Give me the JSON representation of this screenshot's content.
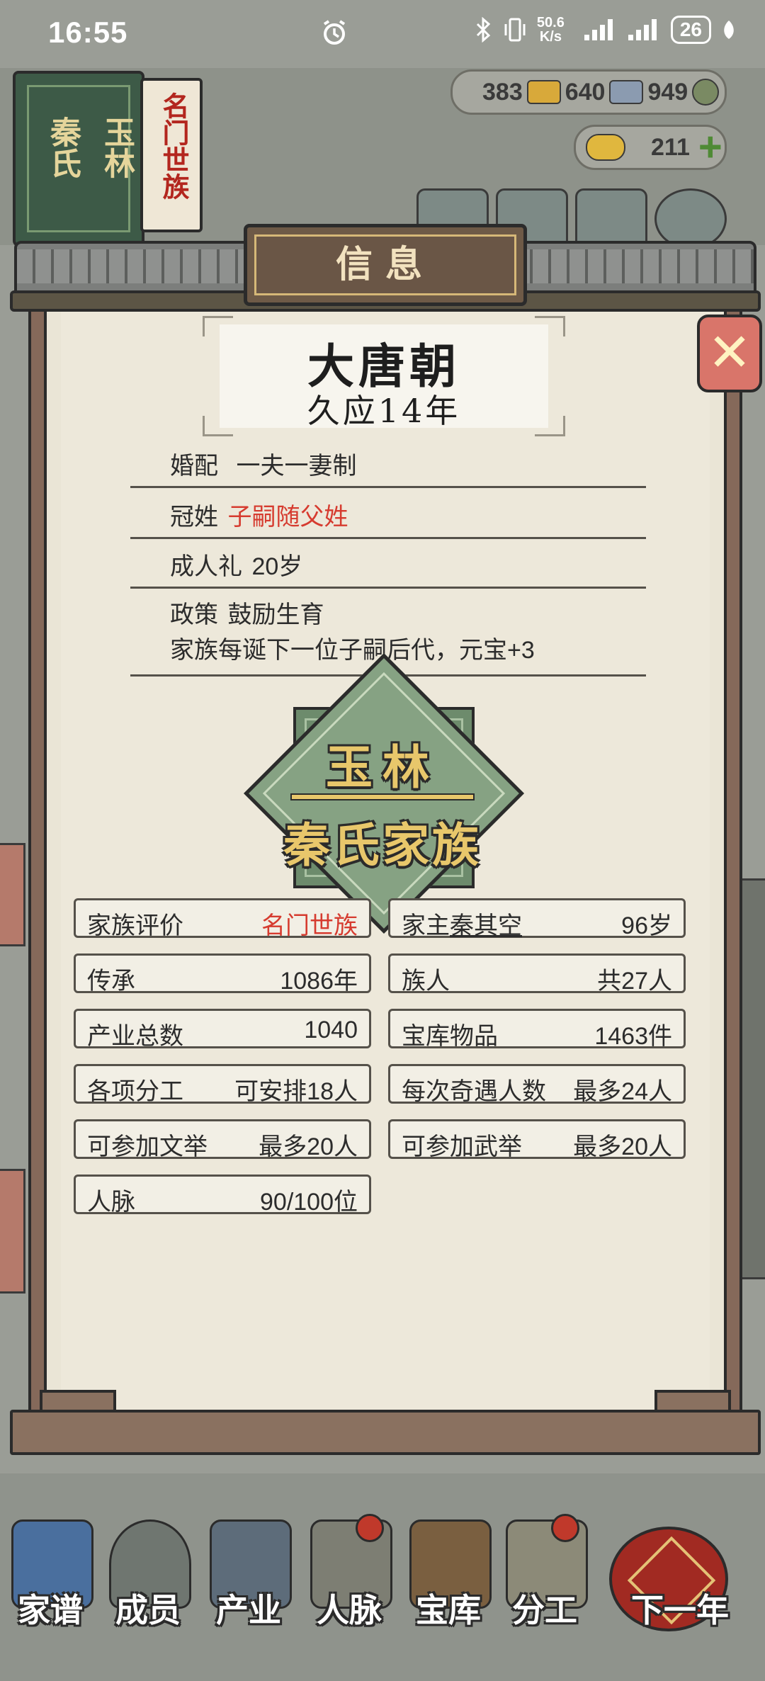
{
  "status_bar": {
    "time": "16:55",
    "net_speed_value": "50.6",
    "net_speed_unit": "K/s",
    "battery": "26"
  },
  "resources": {
    "silver": "383",
    "gold_bars": "640",
    "iron": "949",
    "ingots": "211"
  },
  "background": {
    "book_title_1": "玉林",
    "book_title_2": "秦氏",
    "book_tag": "名门世族"
  },
  "modal": {
    "title": "信息",
    "era": {
      "dynasty": "大唐朝",
      "year": "久应14年"
    },
    "info_rows": [
      {
        "label": "婚配",
        "value": "一夫一妻制"
      },
      {
        "label": "冠姓",
        "value": "子嗣随父姓"
      },
      {
        "label": "成人礼",
        "value": "20岁"
      },
      {
        "label": "政策",
        "value": "鼓励生育",
        "detail": "家族每诞下一位子嗣后代，元宝+3"
      }
    ],
    "emblem": {
      "line1": "玉林",
      "line2": "秦氏家族"
    },
    "stats": [
      {
        "label": "家族评价",
        "value": "名门世族"
      },
      {
        "label": "家主",
        "name": "秦其空",
        "value": "96岁"
      },
      {
        "label": "传承",
        "value": "1086年"
      },
      {
        "label": "族人",
        "value": "共27人"
      },
      {
        "label": "产业总数",
        "value": "1040"
      },
      {
        "label": "宝库物品",
        "value": "1463件"
      },
      {
        "label": "各项分工",
        "value": "可安排18人"
      },
      {
        "label": "每次奇遇人数",
        "value": "最多24人"
      },
      {
        "label": "可参加文举",
        "value": "最多20人"
      },
      {
        "label": "可参加武举",
        "value": "最多20人"
      },
      {
        "label": "人脉",
        "value": "90/100位"
      }
    ]
  },
  "bottom_nav": [
    {
      "label": "家谱"
    },
    {
      "label": "成员"
    },
    {
      "label": "产业"
    },
    {
      "label": "人脉"
    },
    {
      "label": "宝库"
    },
    {
      "label": "分工"
    },
    {
      "label": "下一年"
    }
  ],
  "colors": {
    "highlight_red": "#d63b2f",
    "paper": "#eae5d6",
    "wood": "#85695a",
    "emblem_green": "#86a283",
    "emblem_gold": "#e8c76b"
  }
}
